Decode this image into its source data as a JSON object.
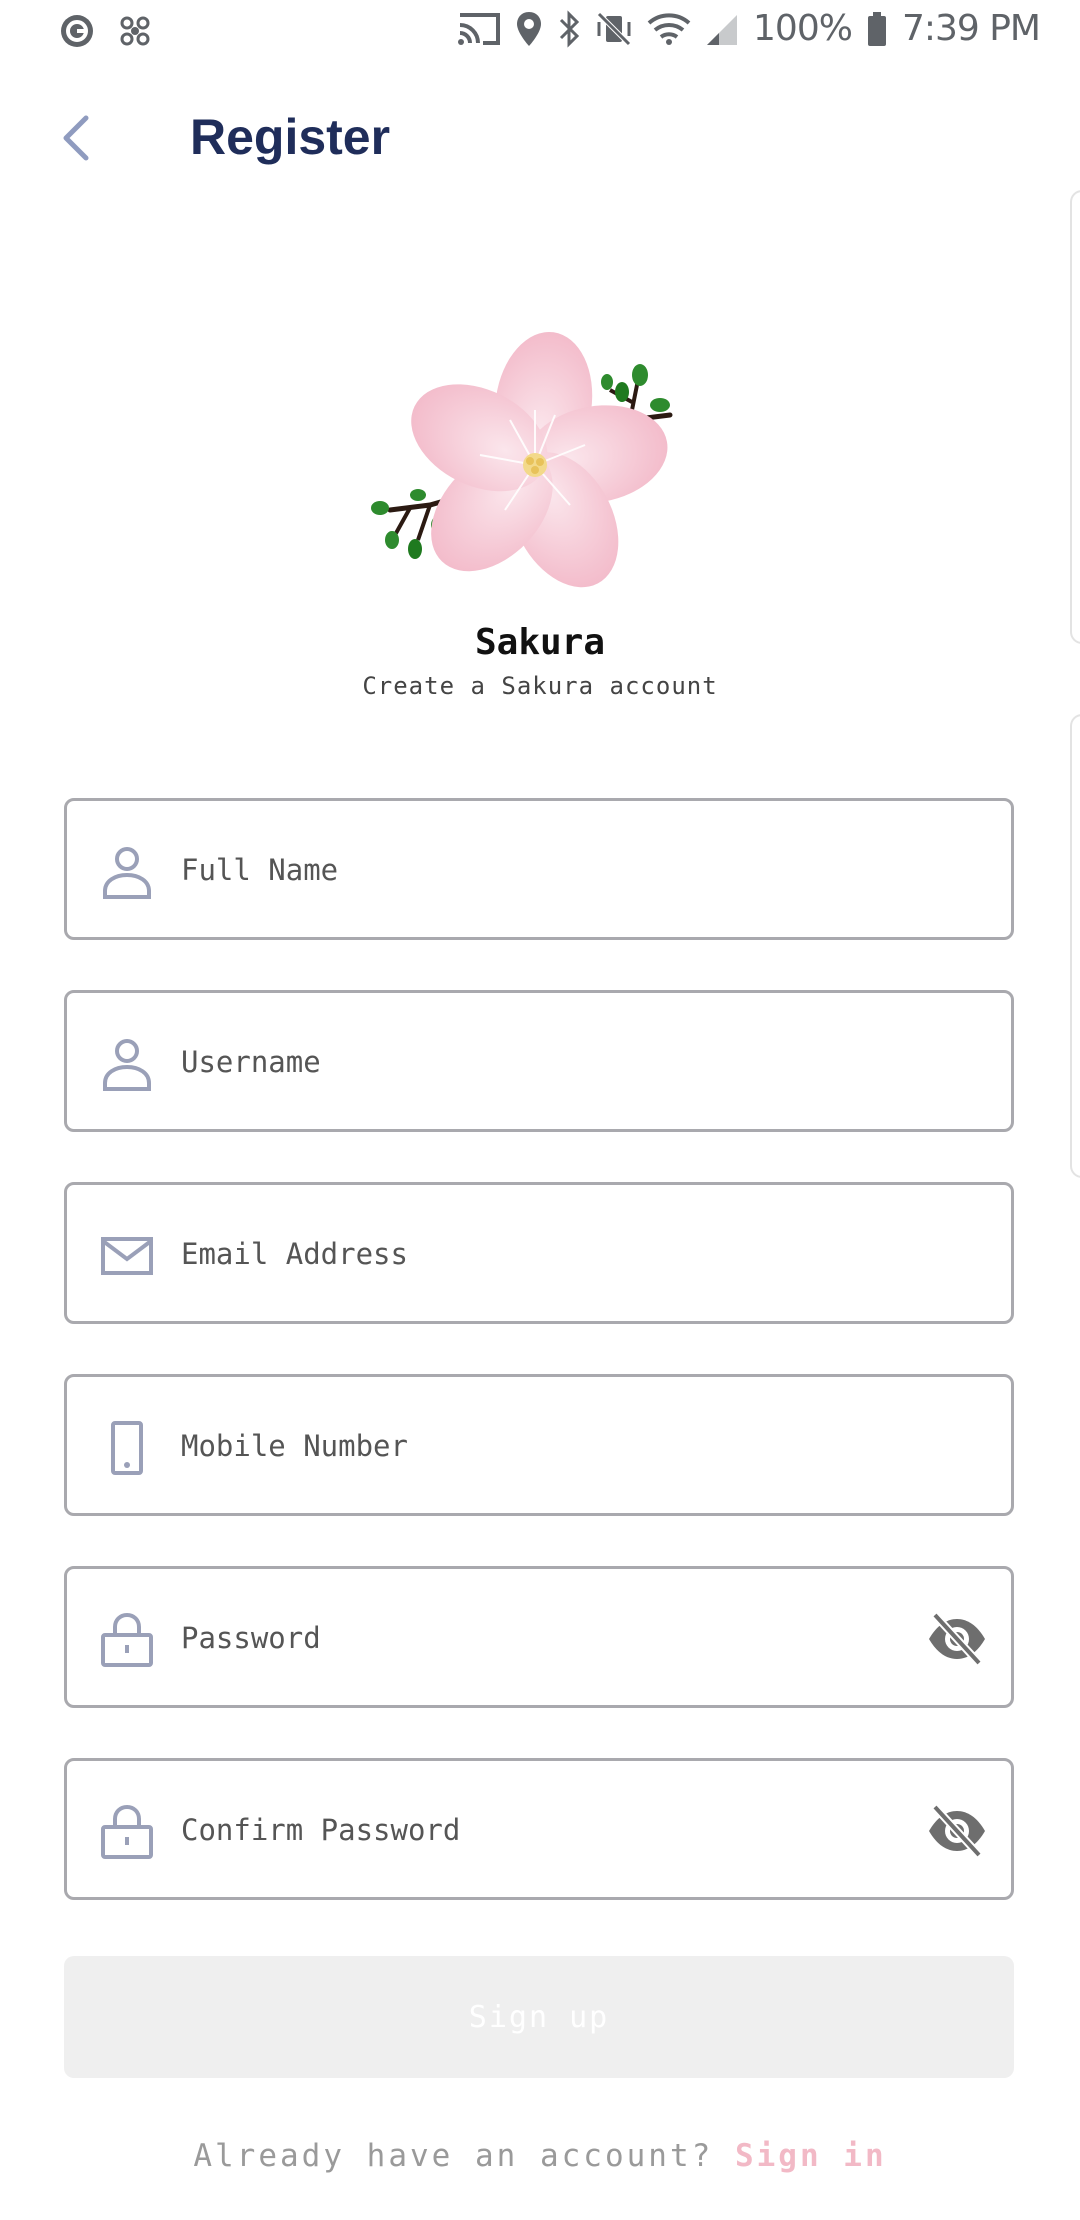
{
  "status_bar": {
    "battery": "100%",
    "time": "7:39 PM",
    "icons": [
      "notification-g-icon",
      "fan-icon",
      "cast-icon",
      "location-icon",
      "bluetooth-icon",
      "mute-vibrate-icon",
      "wifi-icon",
      "signal-icon",
      "battery-icon"
    ]
  },
  "header": {
    "title": "Register"
  },
  "brand": {
    "name": "Sakura",
    "tagline": "Create a Sakura account"
  },
  "form": {
    "full_name": {
      "value": "",
      "placeholder": "Full Name"
    },
    "username": {
      "value": "",
      "placeholder": "Username"
    },
    "email": {
      "value": "",
      "placeholder": "Email Address"
    },
    "mobile": {
      "value": "",
      "placeholder": "Mobile Number"
    },
    "password": {
      "value": "",
      "placeholder": "Password"
    },
    "confirm_password": {
      "value": "",
      "placeholder": "Confirm Password"
    }
  },
  "actions": {
    "signup_label": "Sign up"
  },
  "footer": {
    "prompt": "Already have an account?",
    "signin_label": "Sign in"
  },
  "colors": {
    "title": "#1f2d5a",
    "icon": "#9aa0b8",
    "border": "#a9a9ae",
    "button_disabled": "#efefef",
    "link": "#f2b9c6",
    "petal": "#f6c7d3"
  }
}
